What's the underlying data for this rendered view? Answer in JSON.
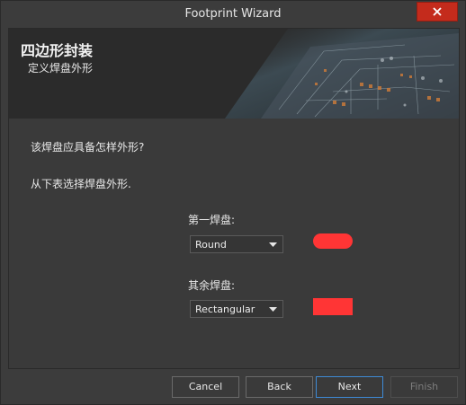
{
  "window": {
    "title": "Footprint Wizard"
  },
  "banner": {
    "title": "四边形封装",
    "subtitle": "定义焊盘外形"
  },
  "main": {
    "question": "该焊盘应具备怎样外形?",
    "instruction": "从下表选择焊盘外形.",
    "first_pad_label": "第一焊盘:",
    "first_pad_shape": "Round",
    "other_pad_label": "其余焊盘:",
    "other_pad_shape": "Rectangular",
    "preview_color": "#ff3535"
  },
  "buttons": {
    "cancel": "Cancel",
    "back": "Back",
    "next": "Next",
    "finish": "Finish"
  }
}
